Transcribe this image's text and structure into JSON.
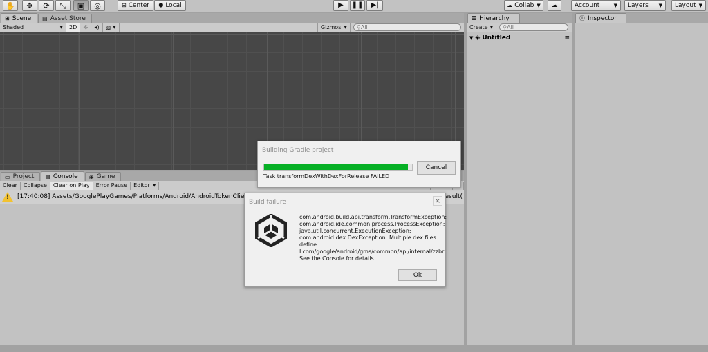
{
  "toolbar": {
    "pivot_label": "Center",
    "space_label": "Local",
    "collab_label": "Collab",
    "account_label": "Account",
    "layers_label": "Layers",
    "layout_label": "Layout"
  },
  "scene_panel": {
    "tabs": [
      {
        "label": "Scene",
        "icon": "scene-icon"
      },
      {
        "label": "Asset Store",
        "icon": "asset-store-icon"
      }
    ],
    "shading_mode": "Shaded",
    "mode_2d": "2D",
    "gizmos_label": "Gizmos",
    "search_placeholder": "All"
  },
  "console_panel": {
    "tabs": [
      {
        "label": "Project",
        "icon": "folder-icon"
      },
      {
        "label": "Console",
        "icon": "console-icon"
      },
      {
        "label": "Game",
        "icon": "game-icon"
      }
    ],
    "buttons": [
      "Clear",
      "Collapse",
      "Clear on Play",
      "Error Pause",
      "Editor"
    ],
    "log_entry": "[17:40:08] Assets/GooglePlayGames/Platforms/Android/AndroidTokenClien",
    "log_entry_tail": "esult("
  },
  "hierarchy_panel": {
    "tab_label": "Hierarchy",
    "create_label": "Create",
    "search_placeholder": "All",
    "scene_name": "Untitled"
  },
  "inspector_panel": {
    "tab_label": "Inspector"
  },
  "gradle_dialog": {
    "title": "Building Gradle project",
    "progress": 0.97,
    "cancel_label": "Cancel",
    "status_text": "Task transformDexWithDexForRelease FAILED"
  },
  "failure_dialog": {
    "title": "Build failure",
    "message_lines": [
      "com.android.build.api.transform.TransformException:",
      "com.android.ide.common.process.ProcessException:",
      "java.util.concurrent.ExecutionException:",
      "com.android.dex.DexException: Multiple dex files",
      "define",
      "Lcom/google/android/gms/common/api/internal/zzbr;",
      "See the Console for details."
    ],
    "ok_label": "Ok",
    "close_glyph": "×"
  },
  "colors": {
    "progress_fill": "#06b025",
    "scene_background": "#474747",
    "warning": "#f2c230"
  }
}
